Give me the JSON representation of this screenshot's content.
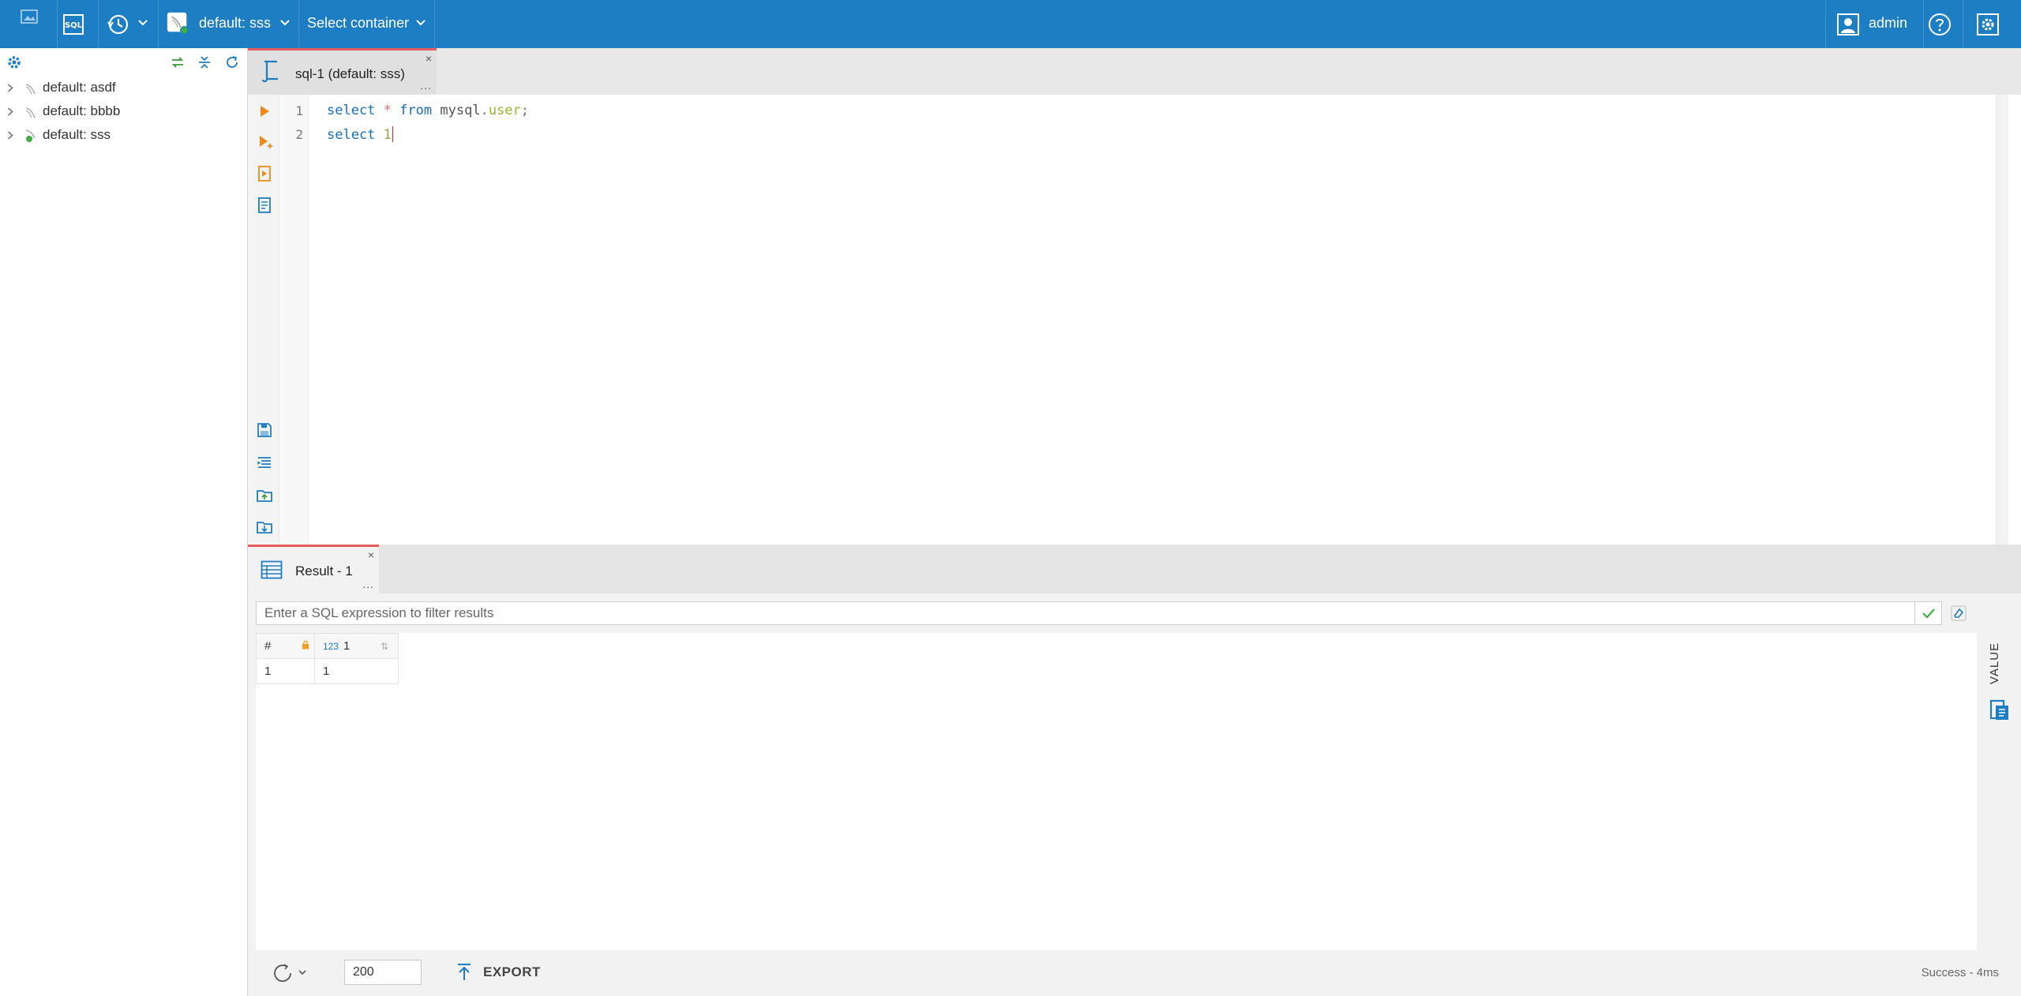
{
  "app": {
    "connection_selector": "default: sss",
    "container_selector": "Select container",
    "user": "admin",
    "colors": {
      "topbar": "#1d7ec4",
      "accent_red": "#e35d5d",
      "keyword": "#1a6fb0",
      "status_ok": "#3cb043"
    }
  },
  "navigator": {
    "connections": [
      {
        "label": "default: asdf",
        "connected": false
      },
      {
        "label": "default: bbbb",
        "connected": false
      },
      {
        "label": "default: sss",
        "connected": true
      }
    ]
  },
  "editor": {
    "tab_label": "sql-1 (default: sss)",
    "tab_close": "×",
    "tab_more": "...",
    "lines": [
      {
        "number": "1",
        "tokens": {
          "k1": "select",
          "op": "*",
          "k2": "from",
          "schema": "mysql",
          "dot": ".",
          "table": "user",
          "semi": ";"
        }
      },
      {
        "number": "2",
        "tokens": {
          "k1": "select",
          "val": "1"
        }
      }
    ]
  },
  "results": {
    "tab_label": "Result - 1",
    "tab_close": "×",
    "tab_more": "...",
    "filter_placeholder": "Enter a SQL expression to filter results",
    "columns": {
      "index": "#",
      "type_badge": "123",
      "name": "1",
      "sort": "⇅"
    },
    "rows": [
      {
        "index": "1",
        "value": "1"
      }
    ],
    "value_panel_label": "VALUE",
    "fetch_size": "200",
    "export_label": "EXPORT",
    "status": "Success - 4ms"
  }
}
